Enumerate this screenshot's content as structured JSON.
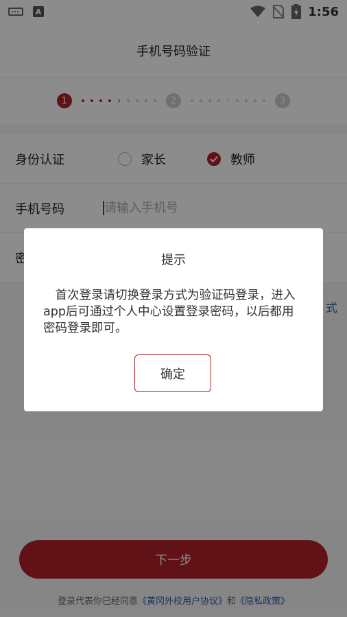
{
  "status_bar": {
    "time": "1:56",
    "notif_letter": "A"
  },
  "app_bar": {
    "title": "手机号码验证"
  },
  "stepper": {
    "steps": [
      "1",
      "2",
      "3"
    ]
  },
  "form": {
    "identity": {
      "label": "身份认证",
      "options": [
        "家长",
        "教师"
      ],
      "selected": "教师"
    },
    "phone": {
      "label": "手机号码",
      "placeholder": "请输入手机号",
      "value": ""
    },
    "password": {
      "label": "密"
    }
  },
  "switch_mode_tail": "式",
  "next_button": {
    "label": "下一步"
  },
  "agreement": {
    "prefix": "登录代表你已经同意",
    "user_agreement": "《黄冈外校用户协议》",
    "and": "和",
    "privacy_policy": "《隐私政策》"
  },
  "dialog": {
    "title": "提示",
    "message": "首次登录请切换登录方式为验证码登录，进入app后可通过个人中心设置登录密码，以后都用密码登录即可。",
    "confirm_label": "确定"
  },
  "colors": {
    "accent": "#b0222b",
    "link": "#2a5caa"
  }
}
